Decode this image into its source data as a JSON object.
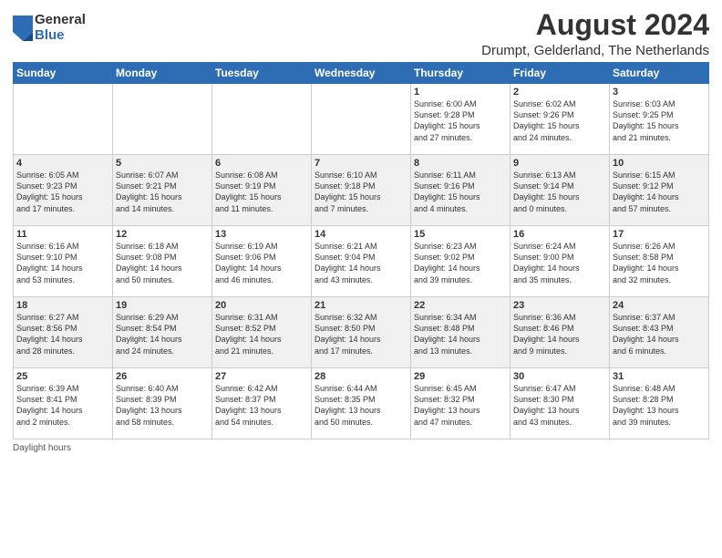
{
  "header": {
    "logo_general": "General",
    "logo_blue": "Blue",
    "month_year": "August 2024",
    "location": "Drumpt, Gelderland, The Netherlands"
  },
  "footer": {
    "daylight_label": "Daylight hours"
  },
  "days_of_week": [
    "Sunday",
    "Monday",
    "Tuesday",
    "Wednesday",
    "Thursday",
    "Friday",
    "Saturday"
  ],
  "weeks": [
    [
      {
        "day": "",
        "content": ""
      },
      {
        "day": "",
        "content": ""
      },
      {
        "day": "",
        "content": ""
      },
      {
        "day": "",
        "content": ""
      },
      {
        "day": "1",
        "content": "Sunrise: 6:00 AM\nSunset: 9:28 PM\nDaylight: 15 hours\nand 27 minutes."
      },
      {
        "day": "2",
        "content": "Sunrise: 6:02 AM\nSunset: 9:26 PM\nDaylight: 15 hours\nand 24 minutes."
      },
      {
        "day": "3",
        "content": "Sunrise: 6:03 AM\nSunset: 9:25 PM\nDaylight: 15 hours\nand 21 minutes."
      }
    ],
    [
      {
        "day": "4",
        "content": "Sunrise: 6:05 AM\nSunset: 9:23 PM\nDaylight: 15 hours\nand 17 minutes."
      },
      {
        "day": "5",
        "content": "Sunrise: 6:07 AM\nSunset: 9:21 PM\nDaylight: 15 hours\nand 14 minutes."
      },
      {
        "day": "6",
        "content": "Sunrise: 6:08 AM\nSunset: 9:19 PM\nDaylight: 15 hours\nand 11 minutes."
      },
      {
        "day": "7",
        "content": "Sunrise: 6:10 AM\nSunset: 9:18 PM\nDaylight: 15 hours\nand 7 minutes."
      },
      {
        "day": "8",
        "content": "Sunrise: 6:11 AM\nSunset: 9:16 PM\nDaylight: 15 hours\nand 4 minutes."
      },
      {
        "day": "9",
        "content": "Sunrise: 6:13 AM\nSunset: 9:14 PM\nDaylight: 15 hours\nand 0 minutes."
      },
      {
        "day": "10",
        "content": "Sunrise: 6:15 AM\nSunset: 9:12 PM\nDaylight: 14 hours\nand 57 minutes."
      }
    ],
    [
      {
        "day": "11",
        "content": "Sunrise: 6:16 AM\nSunset: 9:10 PM\nDaylight: 14 hours\nand 53 minutes."
      },
      {
        "day": "12",
        "content": "Sunrise: 6:18 AM\nSunset: 9:08 PM\nDaylight: 14 hours\nand 50 minutes."
      },
      {
        "day": "13",
        "content": "Sunrise: 6:19 AM\nSunset: 9:06 PM\nDaylight: 14 hours\nand 46 minutes."
      },
      {
        "day": "14",
        "content": "Sunrise: 6:21 AM\nSunset: 9:04 PM\nDaylight: 14 hours\nand 43 minutes."
      },
      {
        "day": "15",
        "content": "Sunrise: 6:23 AM\nSunset: 9:02 PM\nDaylight: 14 hours\nand 39 minutes."
      },
      {
        "day": "16",
        "content": "Sunrise: 6:24 AM\nSunset: 9:00 PM\nDaylight: 14 hours\nand 35 minutes."
      },
      {
        "day": "17",
        "content": "Sunrise: 6:26 AM\nSunset: 8:58 PM\nDaylight: 14 hours\nand 32 minutes."
      }
    ],
    [
      {
        "day": "18",
        "content": "Sunrise: 6:27 AM\nSunset: 8:56 PM\nDaylight: 14 hours\nand 28 minutes."
      },
      {
        "day": "19",
        "content": "Sunrise: 6:29 AM\nSunset: 8:54 PM\nDaylight: 14 hours\nand 24 minutes."
      },
      {
        "day": "20",
        "content": "Sunrise: 6:31 AM\nSunset: 8:52 PM\nDaylight: 14 hours\nand 21 minutes."
      },
      {
        "day": "21",
        "content": "Sunrise: 6:32 AM\nSunset: 8:50 PM\nDaylight: 14 hours\nand 17 minutes."
      },
      {
        "day": "22",
        "content": "Sunrise: 6:34 AM\nSunset: 8:48 PM\nDaylight: 14 hours\nand 13 minutes."
      },
      {
        "day": "23",
        "content": "Sunrise: 6:36 AM\nSunset: 8:46 PM\nDaylight: 14 hours\nand 9 minutes."
      },
      {
        "day": "24",
        "content": "Sunrise: 6:37 AM\nSunset: 8:43 PM\nDaylight: 14 hours\nand 6 minutes."
      }
    ],
    [
      {
        "day": "25",
        "content": "Sunrise: 6:39 AM\nSunset: 8:41 PM\nDaylight: 14 hours\nand 2 minutes."
      },
      {
        "day": "26",
        "content": "Sunrise: 6:40 AM\nSunset: 8:39 PM\nDaylight: 13 hours\nand 58 minutes."
      },
      {
        "day": "27",
        "content": "Sunrise: 6:42 AM\nSunset: 8:37 PM\nDaylight: 13 hours\nand 54 minutes."
      },
      {
        "day": "28",
        "content": "Sunrise: 6:44 AM\nSunset: 8:35 PM\nDaylight: 13 hours\nand 50 minutes."
      },
      {
        "day": "29",
        "content": "Sunrise: 6:45 AM\nSunset: 8:32 PM\nDaylight: 13 hours\nand 47 minutes."
      },
      {
        "day": "30",
        "content": "Sunrise: 6:47 AM\nSunset: 8:30 PM\nDaylight: 13 hours\nand 43 minutes."
      },
      {
        "day": "31",
        "content": "Sunrise: 6:48 AM\nSunset: 8:28 PM\nDaylight: 13 hours\nand 39 minutes."
      }
    ]
  ]
}
